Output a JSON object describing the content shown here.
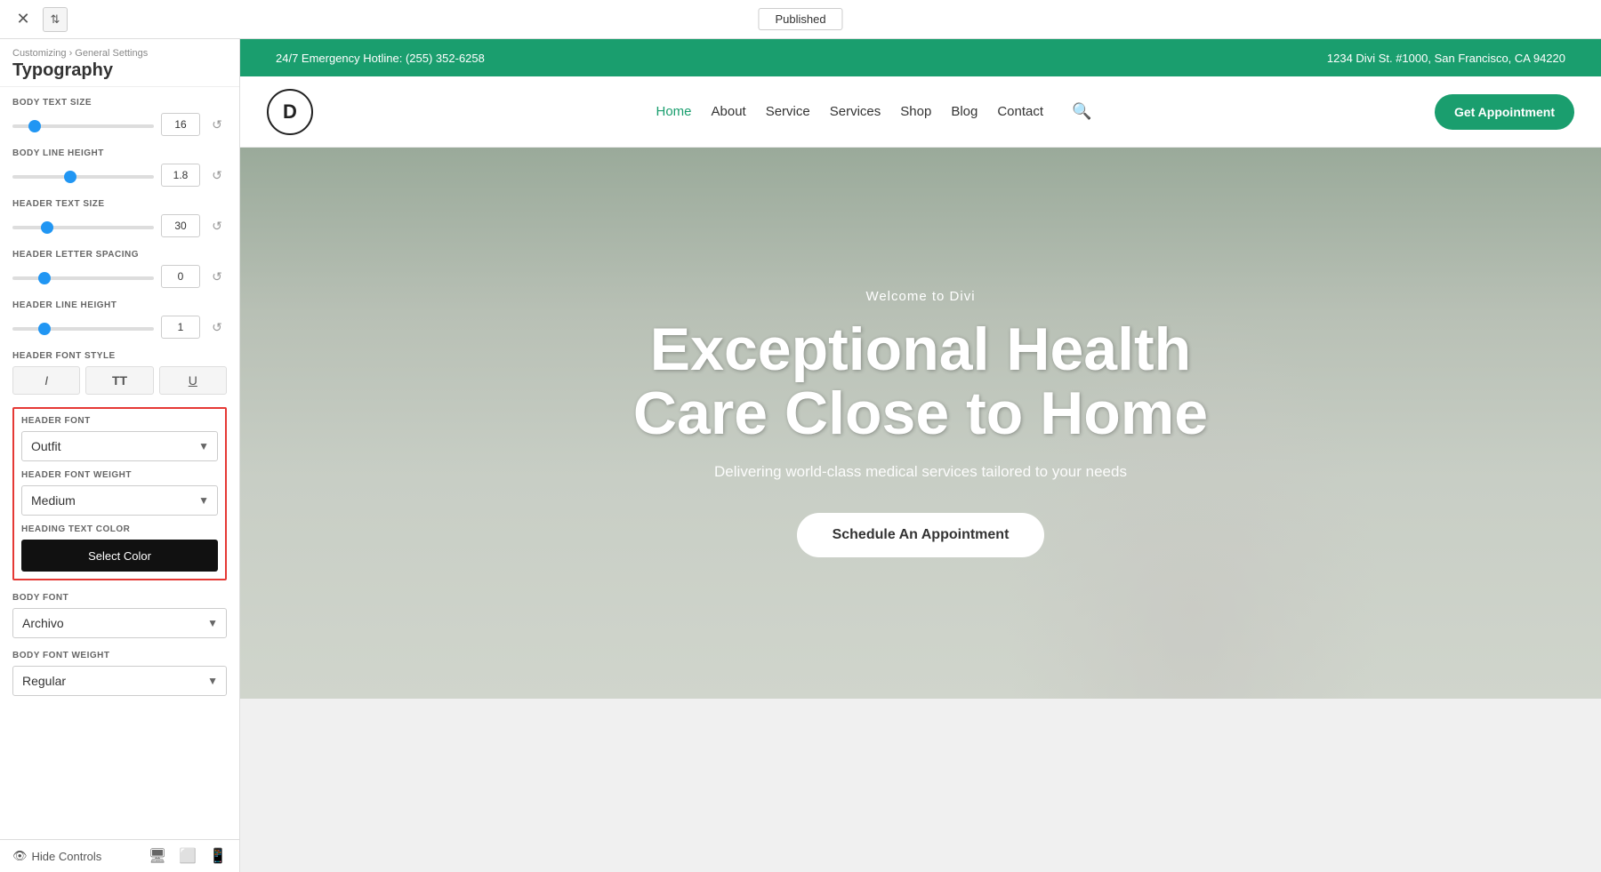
{
  "topbar": {
    "published_label": "Published",
    "close_icon": "✕",
    "swap_icon": "⇅"
  },
  "left_panel": {
    "breadcrumb": "Customizing › General Settings",
    "title": "Typography",
    "settings": {
      "body_text_size_label": "BODY TEXT SIZE",
      "body_text_size_value": "16",
      "body_line_height_label": "BODY LINE HEIGHT",
      "body_line_height_value": "1.8",
      "header_text_size_label": "HEADER TEXT SIZE",
      "header_text_size_value": "30",
      "header_letter_spacing_label": "HEADER LETTER SPACING",
      "header_letter_spacing_value": "0",
      "header_line_height_label": "HEADER LINE HEIGHT",
      "header_line_height_value": "1",
      "header_font_style_label": "HEADER FONT STYLE",
      "italic_icon": "I",
      "bold_icon": "TT",
      "underline_icon": "U",
      "header_font_label": "HEADER FONT",
      "header_font_value": "Outfit",
      "header_font_weight_label": "HEADER FONT WEIGHT",
      "header_font_weight_value": "Medium",
      "heading_text_color_label": "HEADING TEXT COLOR",
      "select_color_label": "Select Color",
      "body_font_label": "BODY FONT",
      "body_font_value": "Archivo",
      "body_font_weight_label": "BODY FONT WEIGHT",
      "body_font_weight_value": "Regular"
    },
    "bottom": {
      "hide_controls_label": "Hide Controls",
      "eye_icon": "👁",
      "desktop_icon": "🖥",
      "tablet_icon": "📱",
      "mobile_icon": "📲"
    }
  },
  "preview": {
    "topbar_left": "24/7 Emergency Hotline: (255) 352-6258",
    "topbar_right": "1234 Divi St. #1000, San Francisco, CA 94220",
    "logo_text": "D",
    "nav_links": [
      "Home",
      "About",
      "Service",
      "Services",
      "Shop",
      "Blog",
      "Contact"
    ],
    "nav_active": "Home",
    "get_appointment_label": "Get Appointment",
    "hero": {
      "welcome": "Welcome to Divi",
      "title_line1": "Exceptional Health",
      "title_line2": "Care Close to Home",
      "subtitle": "Delivering world-class medical services tailored to your needs",
      "cta_button": "Schedule An Appointment"
    }
  },
  "colors": {
    "green": "#1a9e6e",
    "highlight_red": "#e53935"
  }
}
